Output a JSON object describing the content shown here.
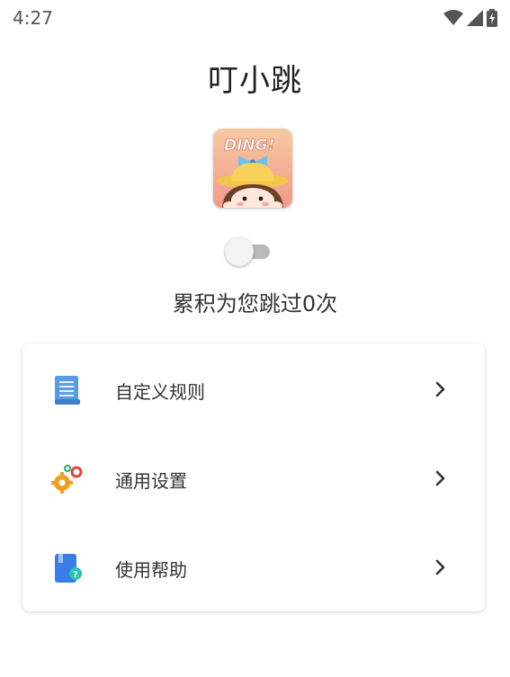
{
  "status_bar": {
    "time": "4:27",
    "icons": [
      "wifi-icon",
      "signal-icon",
      "battery-charging-icon"
    ]
  },
  "app": {
    "title": "叮小跳",
    "logo_text": "DING!"
  },
  "service_toggle": {
    "on": false
  },
  "skip_count_text": "累积为您跳过0次",
  "menu": {
    "items": [
      {
        "label": "自定义规则",
        "icon": "document-list-icon"
      },
      {
        "label": "通用设置",
        "icon": "gears-icon"
      },
      {
        "label": "使用帮助",
        "icon": "help-book-icon"
      }
    ]
  },
  "colors": {
    "doc_icon": "#4a8fe0",
    "gear_orange": "#f0a020",
    "gear_red": "#e0443a",
    "gear_green": "#3bb07a",
    "help_blue": "#3a7de8",
    "help_teal": "#27c4b0"
  }
}
